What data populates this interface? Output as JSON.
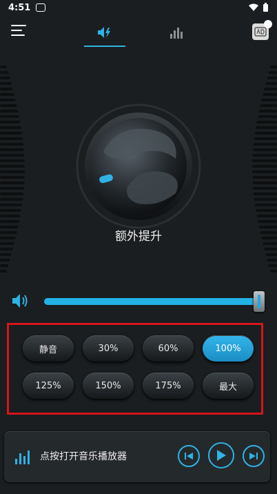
{
  "status_bar": {
    "time": "4:51"
  },
  "main": {
    "knob_label": "额外提升",
    "volume_level": 1.0
  },
  "presets": [
    {
      "label": "静音",
      "active": false
    },
    {
      "label": "30%",
      "active": false
    },
    {
      "label": "60%",
      "active": false
    },
    {
      "label": "100%",
      "active": true
    },
    {
      "label": "125%",
      "active": false
    },
    {
      "label": "150%",
      "active": false
    },
    {
      "label": "175%",
      "active": false
    },
    {
      "label": "最大",
      "active": false
    }
  ],
  "player": {
    "label": "点按打开音乐播放器"
  },
  "colors": {
    "accent": "#2fb3e4",
    "highlight_border": "#d6151b",
    "background": "#1a1e20"
  }
}
